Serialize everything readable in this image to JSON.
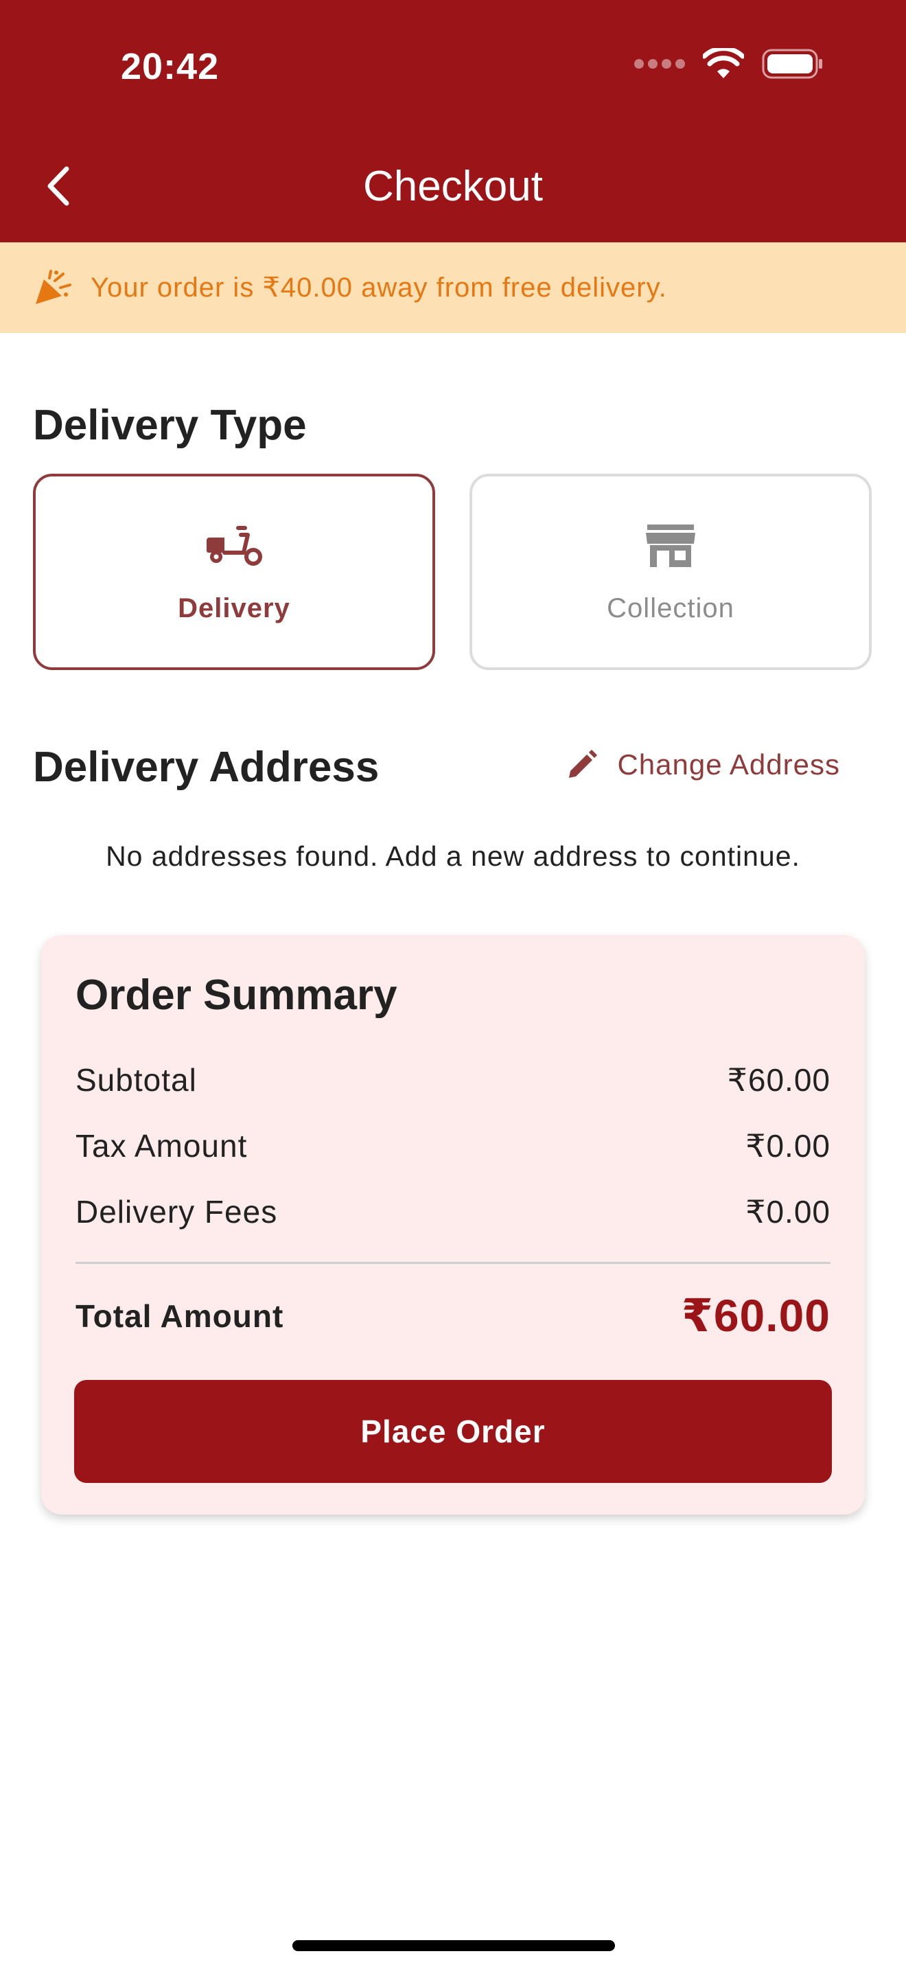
{
  "status_bar": {
    "time": "20:42"
  },
  "header": {
    "title": "Checkout"
  },
  "banner": {
    "text": "Your order is ₹40.00 away from free delivery.",
    "icon": "party-popper-icon"
  },
  "delivery_type": {
    "heading": "Delivery Type",
    "options": [
      {
        "label": "Delivery",
        "icon": "scooter-icon",
        "selected": true
      },
      {
        "label": "Collection",
        "icon": "store-icon",
        "selected": false
      }
    ]
  },
  "delivery_address": {
    "heading": "Delivery Address",
    "change_label": "Change Address",
    "empty_message": "No addresses found. Add a new address to continue."
  },
  "order_summary": {
    "title": "Order Summary",
    "rows": [
      {
        "label": "Subtotal",
        "value": "₹60.00"
      },
      {
        "label": "Tax Amount",
        "value": "₹0.00"
      },
      {
        "label": "Delivery Fees",
        "value": "₹0.00"
      }
    ],
    "total_label": "Total Amount",
    "total_value": "₹60.00",
    "place_order_label": "Place Order"
  },
  "colors": {
    "primary": "#9b1518",
    "accent": "#8f3b3c",
    "banner_bg": "#fde0b3",
    "banner_text": "#e67813",
    "summary_bg": "#fdeceb"
  }
}
